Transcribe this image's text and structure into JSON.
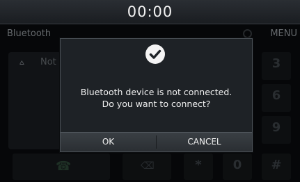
{
  "status_bar": {
    "clock": "00:00"
  },
  "screen": {
    "title": "Bluetooth",
    "menu_label": "MENU",
    "not_paired_text": "Not",
    "not_paired_icon": "bluetooth-off-icon",
    "keypad_keys": [
      "3",
      "6",
      "9"
    ],
    "bottom_keys": [
      "*",
      "0",
      "#"
    ]
  },
  "dialog": {
    "icon": "checkmark-circle-icon",
    "message_line1": "Bluetooth device is not connected.",
    "message_line2": "Do you want to connect?",
    "ok_label": "OK",
    "cancel_label": "CANCEL"
  },
  "colors": {
    "background": "#0a0c0e",
    "popup": "#1e2226",
    "button_bar": "#33383d",
    "text": "#f0f0f0"
  }
}
